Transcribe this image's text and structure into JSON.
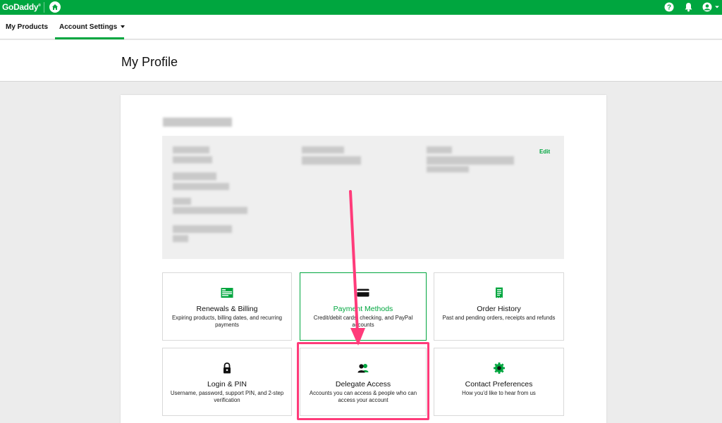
{
  "topbar": {
    "logo": "GoDaddy",
    "logo_tm": "®",
    "help_icon": "question-icon",
    "bell_icon": "bell-icon",
    "user_icon": "user-icon"
  },
  "nav": {
    "my_products": "My Products",
    "account_settings": "Account Settings"
  },
  "page": {
    "title": "My Profile"
  },
  "profile": {
    "edit_label": "Edit"
  },
  "tiles": [
    {
      "title": "Renewals & Billing",
      "desc": "Expiring products, billing dates, and recurring payments",
      "icon": "billing-icon"
    },
    {
      "title": "Payment Methods",
      "desc": "Credit/debit cards, checking, and PayPal accounts",
      "icon": "credit-card-icon"
    },
    {
      "title": "Order History",
      "desc": "Past and pending orders, receipts and refunds",
      "icon": "receipt-icon"
    },
    {
      "title": "Login & PIN",
      "desc": "Username, password, support PIN, and 2-step verification",
      "icon": "lock-icon"
    },
    {
      "title": "Delegate Access",
      "desc": "Accounts you can access & people who can access your account",
      "icon": "people-icon"
    },
    {
      "title": "Contact Preferences",
      "desc": "How you'd like to hear from us",
      "icon": "gear-icon"
    }
  ],
  "colors": {
    "brand": "#00a63f",
    "highlight": "#ff3b7a"
  }
}
